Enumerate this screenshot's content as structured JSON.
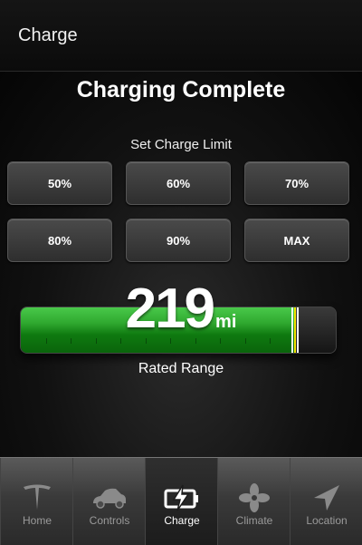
{
  "header": {
    "title": "Charge"
  },
  "charge": {
    "status": "Charging Complete",
    "limit_label": "Set Charge Limit",
    "limit_options": [
      "50%",
      "60%",
      "70%",
      "80%",
      "90%",
      "MAX"
    ],
    "range_value": "219",
    "range_unit": "mi",
    "range_label": "Rated Range",
    "battery_level": 0.87,
    "limit_marker_level": 0.87
  },
  "tabs": [
    {
      "label": "Home",
      "icon": "tesla-logo-icon",
      "active": false
    },
    {
      "label": "Controls",
      "icon": "car-icon",
      "active": false
    },
    {
      "label": "Charge",
      "icon": "battery-charge-icon",
      "active": true
    },
    {
      "label": "Climate",
      "icon": "fan-icon",
      "active": false
    },
    {
      "label": "Location",
      "icon": "location-arrow-icon",
      "active": false
    }
  ],
  "colors": {
    "battery_green": "#2fa82f",
    "limit_marker_yellow": "#f1e400",
    "background": "#000000"
  }
}
